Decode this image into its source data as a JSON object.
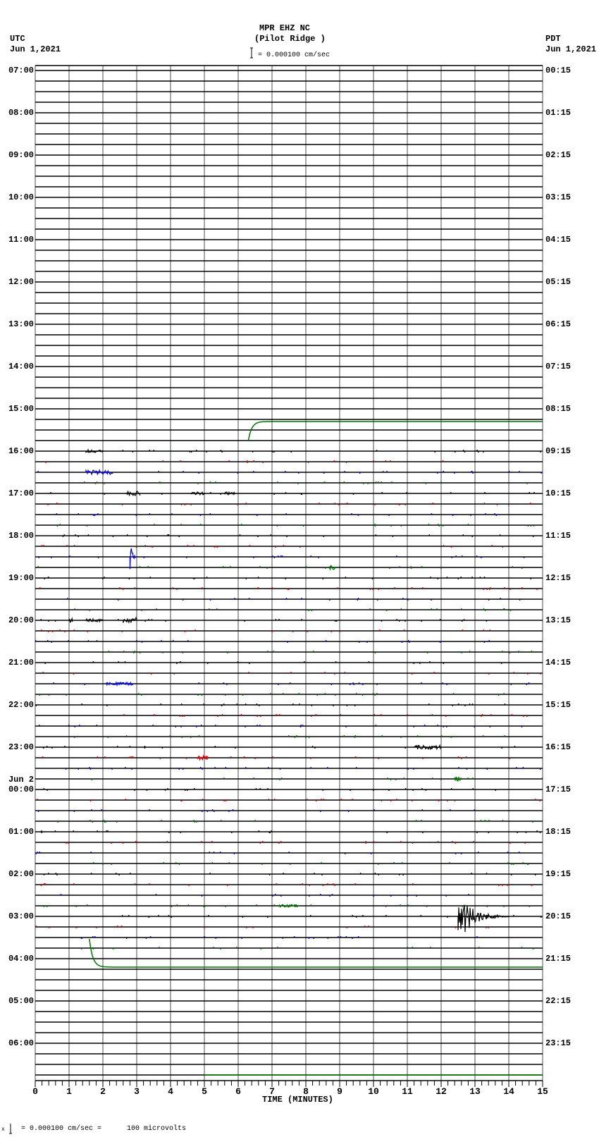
{
  "header": {
    "station": "MPR EHZ NC",
    "site": "(Pilot Ridge )",
    "scale": "= 0.000100 cm/sec",
    "left_zone": "UTC",
    "left_date": "Jun 1,2021",
    "right_zone": "PDT",
    "right_date": "Jun 1,2021"
  },
  "footer": {
    "mark": "x",
    "scale": "= 0.000100 cm/sec =      100 microvolts"
  },
  "colors": {
    "trace_cycle": [
      "#000000",
      "#dd0000",
      "#0000dd",
      "#007700"
    ],
    "grid": "#888888"
  },
  "chart_data": {
    "type": "line",
    "title": "MPR EHZ NC (Pilot Ridge )",
    "xlabel": "TIME (MINUTES)",
    "xlim": [
      0,
      15
    ],
    "x_ticks": [
      "0",
      "1",
      "2",
      "3",
      "4",
      "5",
      "6",
      "7",
      "8",
      "9",
      "10",
      "11",
      "12",
      "13",
      "14",
      "15"
    ],
    "rows_per_hour": 4,
    "minutes_per_row": 15,
    "left_labels": [
      "07:00",
      "08:00",
      "09:00",
      "10:00",
      "11:00",
      "12:00",
      "13:00",
      "14:00",
      "15:00",
      "16:00",
      "17:00",
      "18:00",
      "19:00",
      "20:00",
      "21:00",
      "22:00",
      "23:00",
      "00:00",
      "01:00",
      "02:00",
      "03:00",
      "04:00",
      "05:00",
      "06:00"
    ],
    "date_change_label": "Jun 2",
    "right_labels": [
      "00:15",
      "01:15",
      "02:15",
      "03:15",
      "04:15",
      "05:15",
      "06:15",
      "07:15",
      "08:15",
      "09:15",
      "10:15",
      "11:15",
      "12:15",
      "13:15",
      "14:15",
      "15:15",
      "16:15",
      "17:15",
      "18:15",
      "19:15",
      "20:15",
      "21:15",
      "22:15",
      "23:15"
    ],
    "active_rows": [
      36,
      83
    ],
    "events": [
      {
        "row": "16:00",
        "start": 1.5,
        "end": 2.0,
        "amp": 2
      },
      {
        "row": "16:30",
        "start": 1.5,
        "end": 2.3,
        "amp": 3
      },
      {
        "row": "17:00",
        "start": 2.7,
        "end": 3.1,
        "amp": 3
      },
      {
        "row": "17:00",
        "start": 4.6,
        "end": 5.0,
        "amp": 2
      },
      {
        "row": "17:00",
        "start": 5.6,
        "end": 5.9,
        "amp": 2
      },
      {
        "row": "18:30",
        "start": 2.8,
        "end": 3.0,
        "amp": 35
      },
      {
        "row": "18:45",
        "start": 8.7,
        "end": 8.9,
        "amp": 3
      },
      {
        "row": "20:00",
        "start": 1.0,
        "end": 1.1,
        "amp": 3
      },
      {
        "row": "20:00",
        "start": 1.5,
        "end": 2.0,
        "amp": 2
      },
      {
        "row": "20:00",
        "start": 2.6,
        "end": 3.0,
        "amp": 4
      },
      {
        "row": "21:30",
        "start": 2.1,
        "end": 2.9,
        "amp": 2
      },
      {
        "row": "23:00",
        "start": 11.2,
        "end": 12.0,
        "amp": 3
      },
      {
        "row": "23:15",
        "start": 4.8,
        "end": 5.1,
        "amp": 3
      },
      {
        "row": "23:45",
        "start": 12.4,
        "end": 12.6,
        "amp": 3
      },
      {
        "row": "02:45",
        "start": 7.2,
        "end": 7.8,
        "amp": 2
      },
      {
        "row": "03:00",
        "start": 12.5,
        "end": 14.0,
        "amp": 40
      }
    ],
    "offsets": [
      {
        "row": "15:45",
        "start": 6.3,
        "offset_from": 0,
        "offset_to": -27
      },
      {
        "row": "03:45",
        "start": 1.6,
        "offset_from": -13,
        "offset_to": 27
      },
      {
        "row": "06:45",
        "start": 5.0,
        "offset_from": 0,
        "offset_to": 0
      }
    ]
  }
}
